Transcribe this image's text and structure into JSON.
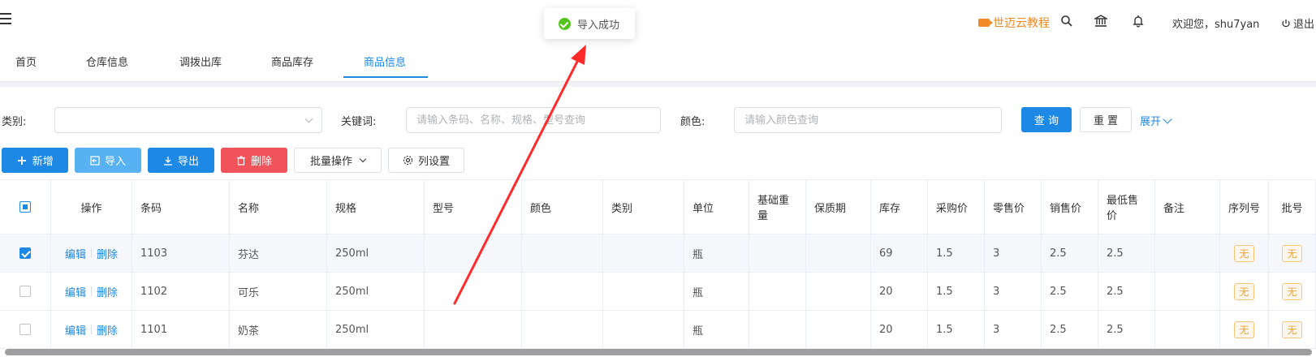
{
  "header": {
    "brand": "世迈云教程",
    "welcome": "欢迎您，shu7yan",
    "logout": "退出"
  },
  "toast": {
    "message": "导入成功"
  },
  "tabs": [
    {
      "label": "首页"
    },
    {
      "label": "仓库信息"
    },
    {
      "label": "调拨出库"
    },
    {
      "label": "商品库存"
    },
    {
      "label": "商品信息"
    }
  ],
  "filters": {
    "category_label": "类别:",
    "keyword_label": "关键词:",
    "keyword_placeholder": "请输入条码、名称、规格、型号查询",
    "color_label": "颜色:",
    "color_placeholder": "请输入颜色查询",
    "query": "查 询",
    "reset": "重 置",
    "expand": "展开"
  },
  "toolbar": {
    "add": "新增",
    "import": "导入",
    "export": "导出",
    "delete": "删除",
    "batch": "批量操作",
    "columns": "列设置"
  },
  "table": {
    "headers": [
      "操作",
      "条码",
      "名称",
      "规格",
      "型号",
      "颜色",
      "类别",
      "单位",
      "基础重量",
      "保质期",
      "库存",
      "采购价",
      "零售价",
      "销售价",
      "最低售价",
      "备注",
      "序列号",
      "批号"
    ],
    "actions": {
      "edit": "编辑",
      "delete": "删除"
    },
    "rows": [
      {
        "checked": true,
        "barcode": "1103",
        "name": "芬达",
        "spec": "250ml",
        "model": "",
        "color": "",
        "category": "",
        "unit": "瓶",
        "weight": "",
        "shelf": "",
        "stock": "69",
        "purchase": "1.5",
        "retail": "3",
        "sale": "2.5",
        "min": "2.5",
        "remark": "",
        "serial": "无",
        "batch": "无"
      },
      {
        "checked": false,
        "barcode": "1102",
        "name": "可乐",
        "spec": "250ml",
        "model": "",
        "color": "",
        "category": "",
        "unit": "瓶",
        "weight": "",
        "shelf": "",
        "stock": "20",
        "purchase": "1.5",
        "retail": "3",
        "sale": "2.5",
        "min": "2.5",
        "remark": "",
        "serial": "无",
        "batch": "无"
      },
      {
        "checked": false,
        "barcode": "1101",
        "name": "奶茶",
        "spec": "250ml",
        "model": "",
        "color": "",
        "category": "",
        "unit": "瓶",
        "weight": "",
        "shelf": "",
        "stock": "20",
        "purchase": "1.5",
        "retail": "3",
        "sale": "2.5",
        "min": "2.5",
        "remark": "",
        "serial": "无",
        "batch": "无"
      }
    ]
  },
  "colors": {
    "primary": "#1e88e5",
    "danger": "#f0545a",
    "brand": "#f08a24",
    "success": "#52c41a",
    "arrow": "#ff2a2a"
  }
}
